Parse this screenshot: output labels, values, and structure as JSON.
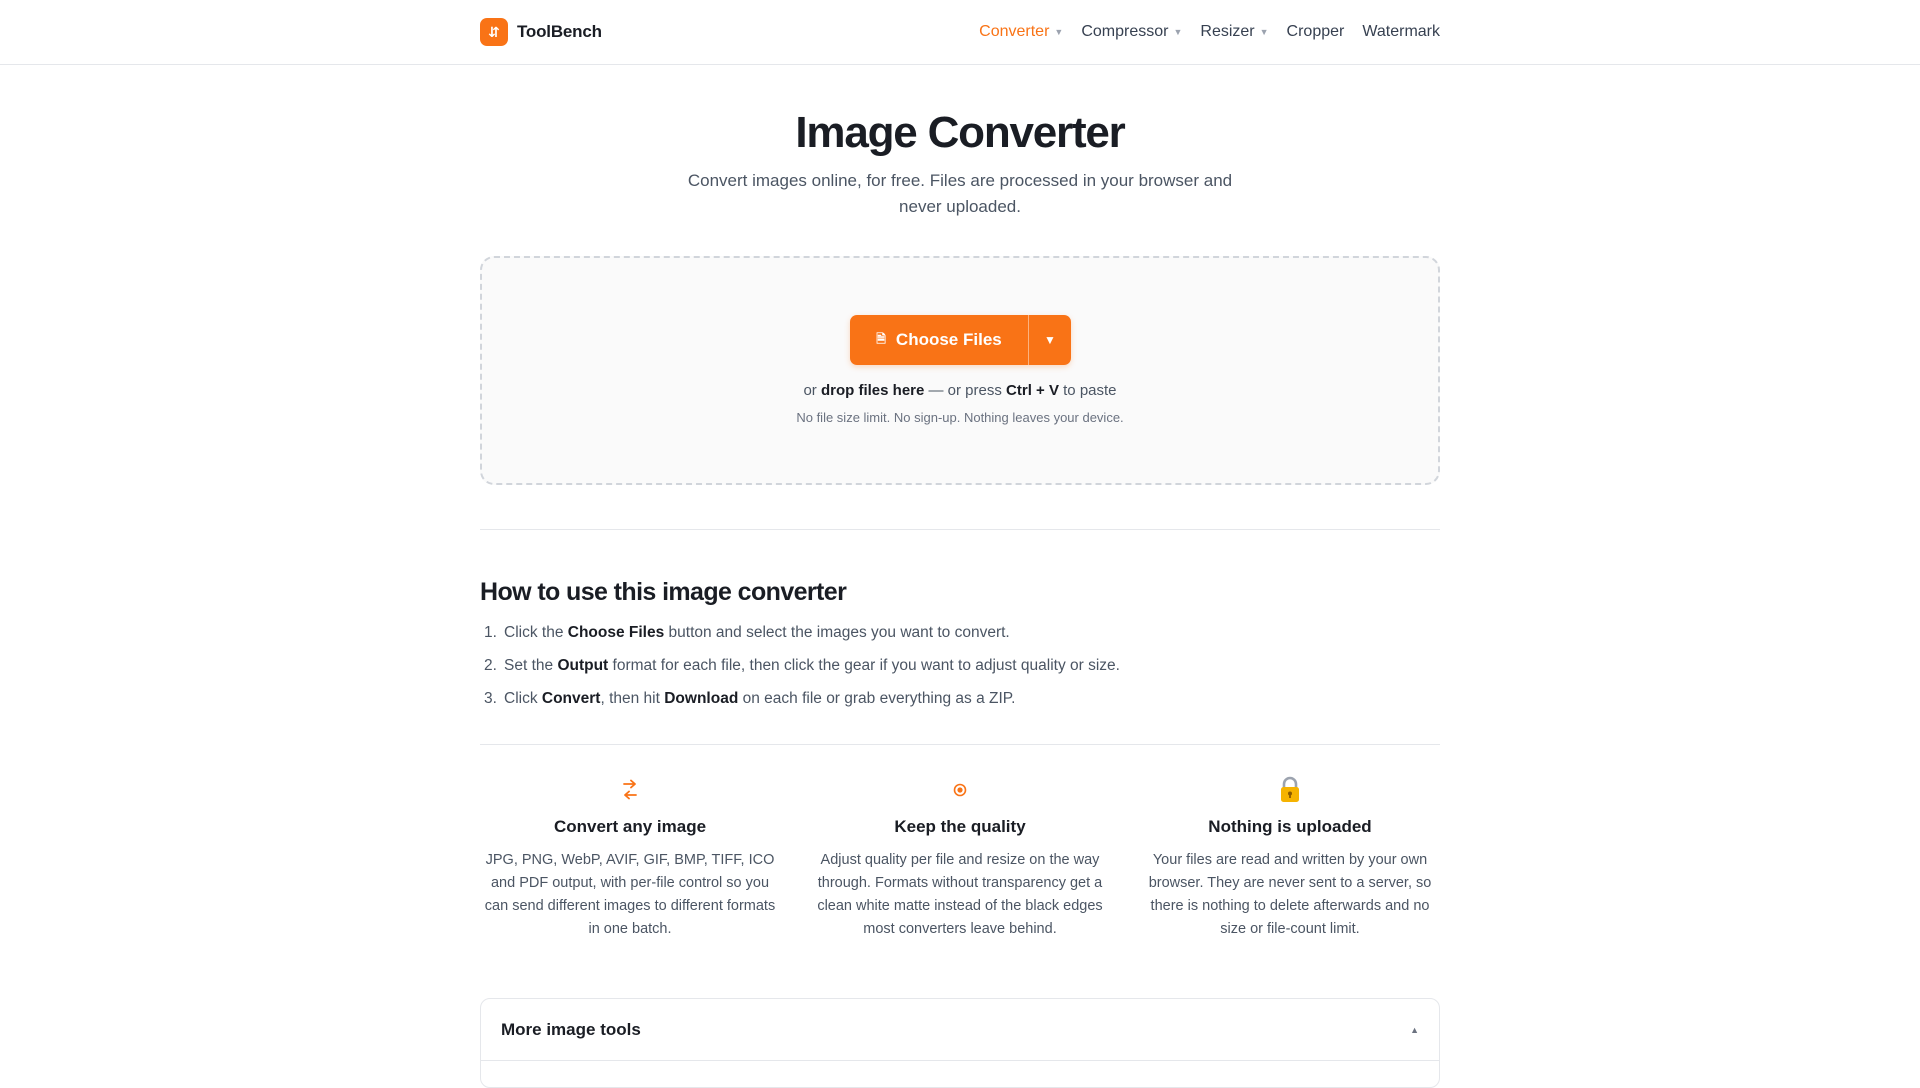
{
  "header": {
    "brand_name": "ToolBench",
    "nav": [
      {
        "label": "Converter",
        "caret": "▼",
        "active": true
      },
      {
        "label": "Compressor",
        "caret": "▼"
      },
      {
        "label": "Resizer",
        "caret": "▼"
      },
      {
        "label": "Cropper"
      },
      {
        "label": "Watermark"
      }
    ]
  },
  "hero": {
    "title": "Image Converter",
    "subtitle": "Convert images online, for free. Files are processed in your browser and never uploaded."
  },
  "dropzone": {
    "choose_label": "Choose Files",
    "caret": "▼",
    "line_prefix": "or ",
    "line_drop": "drop files here",
    "line_middle": " — or press ",
    "line_shortcut": "Ctrl + V",
    "line_suffix": " to paste",
    "note": "No file size limit. No sign-up. Nothing leaves your device."
  },
  "how_to": {
    "title": "How to use this image converter",
    "steps": [
      {
        "num": "1.",
        "pre": "Click the ",
        "bold": "Choose Files",
        "post": " button and select the images you want to convert."
      },
      {
        "num": "2.",
        "pre": "Set the ",
        "bold": "Output",
        "post": " format for each file, then click the gear if you want to adjust quality or size."
      },
      {
        "num": "3.",
        "pre": "Click ",
        "bold": "Convert",
        "mid": ", then hit ",
        "bold2": "Download",
        "post": " on each file or grab everything as a ZIP."
      }
    ]
  },
  "features": [
    {
      "icon": "convert-arrows-icon",
      "title": "Convert any image",
      "desc": "JPG, PNG, WebP, AVIF, GIF, BMP, TIFF, ICO and PDF output, with per-file control so you can send different images to different formats in one batch."
    },
    {
      "icon": "target-icon",
      "title": "Keep the quality",
      "desc": "Adjust quality per file and resize on the way through. Formats without transparency get a clean white matte instead of the black edges most converters leave behind."
    },
    {
      "icon": "lock-icon",
      "title": "Nothing is uploaded",
      "desc": "Your files are read and written by your own browser. They are never sent to a server, so there is nothing to delete afterwards and no size or file-count limit."
    }
  ],
  "more_tools": {
    "title": "More image tools",
    "caret": "▲"
  },
  "colors": {
    "accent": "#f97316",
    "text": "#1a1d24",
    "muted": "#4b5563",
    "border": "#e5e7eb"
  }
}
